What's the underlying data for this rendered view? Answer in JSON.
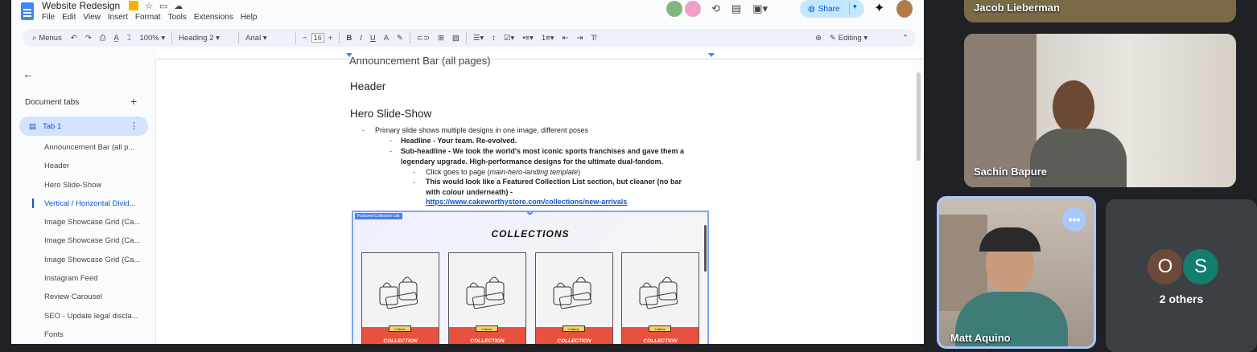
{
  "docs": {
    "title": "Website Redesign",
    "menu": [
      "File",
      "Edit",
      "View",
      "Insert",
      "Format",
      "Tools",
      "Extensions",
      "Help"
    ],
    "share_label": "Share",
    "toolbar": {
      "search_label": "Menus",
      "zoom": "100%",
      "style": "Heading 2",
      "font": "Arial",
      "font_size": "16",
      "mode": "Editing"
    },
    "sidebar": {
      "tabs_heading": "Document tabs",
      "tab1_label": "Tab 1",
      "outline": [
        "Announcement Bar (all p...",
        "Header",
        "Hero Slide-Show",
        "Vertical / Horizontal Divid...",
        "Image Showcase Grid (Ca...",
        "Image Showcase Grid (Ca...",
        "Image Showcase Grid (Ca...",
        "Instagram Feed",
        "Review Carousel",
        "SEO - Update legal discla...",
        "Fonts"
      ]
    },
    "content": {
      "clipped_heading": "Announcement Bar (all pages)",
      "header_heading": "Header",
      "hero_heading": "Hero Slide-Show",
      "bullet1": "Primary slide shows multiple designs in one image, different poses",
      "bullet2": "Headline - Your team.  Re-evolved.",
      "bullet3_line1": "Sub-headline - We took the world's most iconic sports franchises and gave them a",
      "bullet3_line2": "legendary upgrade. High-performance designs for the ultimate dual-fandom.",
      "bullet4_prefix": "Click goes to page (",
      "bullet4_italic": "main-hero-landing template",
      "bullet4_suffix": ")",
      "bullet5_line1": "This would look like a Featured Collection List section, but cleaner (no bar",
      "bullet5_line2": "with colour underneath) -",
      "bullet5_link": "https://www.cakeworthystore.com/collections/new-arrivals",
      "embed": {
        "label": "Featured Collection List",
        "title": "COLLECTIONS",
        "cards": [
          {
            "tag": "0 items",
            "label": "COLLECTION"
          },
          {
            "tag": "0 items",
            "label": "COLLECTION"
          },
          {
            "tag": "0 items",
            "label": "COLLECTION"
          },
          {
            "tag": "0 items",
            "label": "COLLECTION"
          }
        ]
      }
    }
  },
  "meet": {
    "participants": [
      {
        "name": "Jacob Lieberman"
      },
      {
        "name": "Sachin Bapure"
      },
      {
        "name": "Matt Aquino"
      }
    ],
    "others": {
      "initials": [
        "O",
        "S"
      ],
      "label": "2 others"
    }
  },
  "colors": {
    "accent": "#0b57d0",
    "share_bg": "#c2e7ff",
    "collection_red": "#e7513d"
  }
}
